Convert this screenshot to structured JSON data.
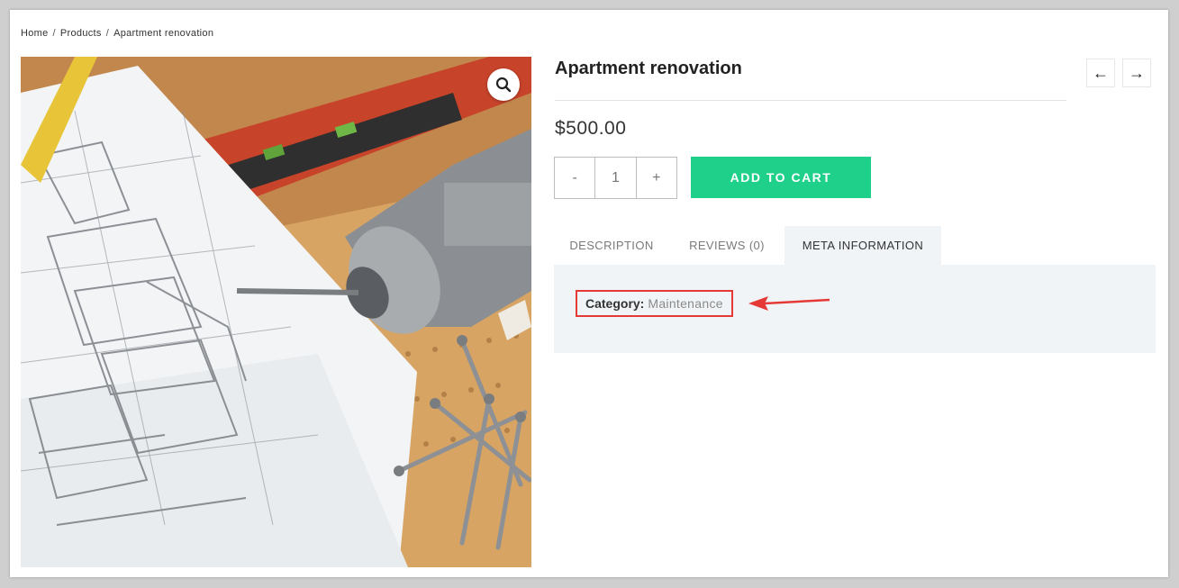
{
  "breadcrumb": {
    "home": "Home",
    "products": "Products",
    "current": "Apartment renovation",
    "separator": "/"
  },
  "product": {
    "title": "Apartment renovation",
    "price": "$500.00",
    "image_alt": "drill, blueprints, level and screws on a wooden table"
  },
  "quantity": {
    "minus": "-",
    "value": "1",
    "plus": "+"
  },
  "add_to_cart": "ADD TO CART",
  "nav": {
    "prev": "←",
    "next": "→"
  },
  "tabs": [
    {
      "label": "DESCRIPTION"
    },
    {
      "label": "REVIEWS (0)"
    },
    {
      "label": "META INFORMATION",
      "active": true
    }
  ],
  "meta": {
    "category_label": "Category:",
    "category_value": "Maintenance"
  },
  "colors": {
    "accent": "#1fd08a",
    "highlight": "#e53935",
    "panel": "#f1f4f7"
  }
}
